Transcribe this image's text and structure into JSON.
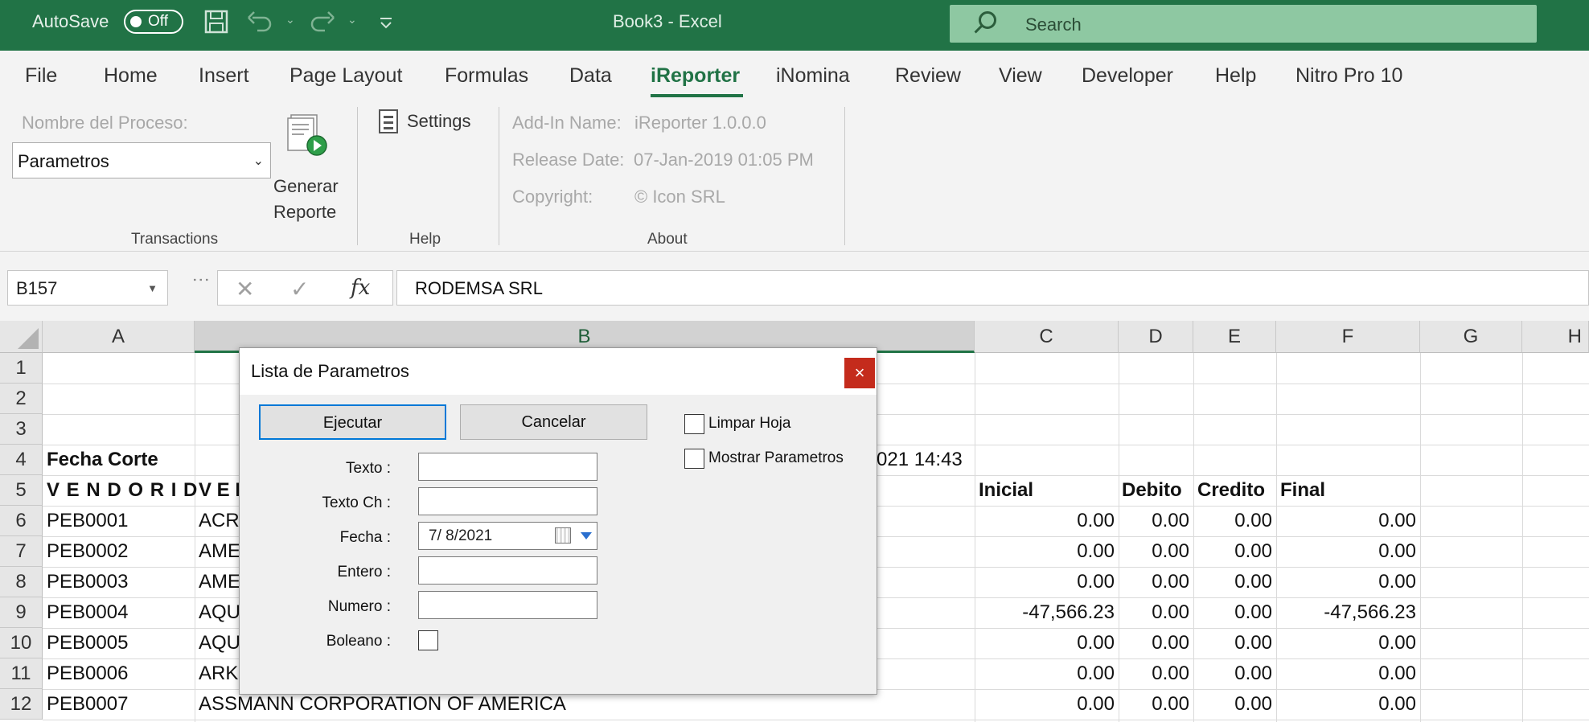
{
  "titlebar": {
    "autosave_label": "AutoSave",
    "autosave_state": "Off",
    "window_title": "Book3  -  Excel",
    "search_placeholder": "Search"
  },
  "menu": {
    "tabs": [
      {
        "label": "File"
      },
      {
        "label": "Home"
      },
      {
        "label": "Insert"
      },
      {
        "label": "Page Layout"
      },
      {
        "label": "Formulas"
      },
      {
        "label": "Data"
      },
      {
        "label": "iReporter",
        "active": true
      },
      {
        "label": "iNomina"
      },
      {
        "label": "Review"
      },
      {
        "label": "View"
      },
      {
        "label": "Developer"
      },
      {
        "label": "Help"
      },
      {
        "label": "Nitro Pro 10"
      }
    ]
  },
  "ribbon": {
    "transactions": {
      "process_label": "Nombre del Proceso:",
      "process_value": "Parametros",
      "generate_line1": "Generar",
      "generate_line2": "Reporte",
      "group_name": "Transactions"
    },
    "help": {
      "settings_label": "Settings",
      "group_name": "Help"
    },
    "about": {
      "addin_label": "Add-In Name:",
      "addin_value": "iReporter 1.0.0.0",
      "release_label": "Release Date:",
      "release_value": "07-Jan-2019 01:05 PM",
      "copyright_label": "Copyright:",
      "copyright_value": "© Icon SRL",
      "group_name": "About"
    }
  },
  "formula_bar": {
    "name_box": "B157",
    "fx_label": "fx",
    "content": "RODEMSA SRL"
  },
  "grid": {
    "columns": [
      "A",
      "B",
      "C",
      "D",
      "E",
      "F",
      "G",
      "H"
    ],
    "rows": [
      "1",
      "2",
      "3",
      "4",
      "5",
      "6",
      "7",
      "8",
      "9",
      "10",
      "11",
      "12"
    ],
    "cells": {
      "a4": "Fecha Corte",
      "b4_tail": "021 14:43",
      "a5": "V E N D O R I D",
      "b5": "V E I",
      "c5": "Inicial",
      "d5": "Debito",
      "e5": "Credito",
      "f5": "Final"
    },
    "data_rows": [
      {
        "a": "PEB0001",
        "b": "ACR",
        "c": "0.00",
        "d": "0.00",
        "e": "0.00",
        "f": "0.00"
      },
      {
        "a": "PEB0002",
        "b": "AME",
        "c": "0.00",
        "d": "0.00",
        "e": "0.00",
        "f": "0.00"
      },
      {
        "a": "PEB0003",
        "b": "AME",
        "c": "0.00",
        "d": "0.00",
        "e": "0.00",
        "f": "0.00"
      },
      {
        "a": "PEB0004",
        "b": "AQU",
        "c": "-47,566.23",
        "d": "0.00",
        "e": "0.00",
        "f": "-47,566.23"
      },
      {
        "a": "PEB0005",
        "b": "AQU",
        "c": "0.00",
        "d": "0.00",
        "e": "0.00",
        "f": "0.00"
      },
      {
        "a": "PEB0006",
        "b": "ARKI",
        "c": "0.00",
        "d": "0.00",
        "e": "0.00",
        "f": "0.00"
      },
      {
        "a": "PEB0007",
        "b": "ASSMANN CORPORATION OF AMERICA",
        "c": "0.00",
        "d": "0.00",
        "e": "0.00",
        "f": "0.00"
      }
    ]
  },
  "dialog": {
    "title": "Lista de Parametros",
    "close": "×",
    "execute_label": "Ejecutar",
    "cancel_label": "Cancelar",
    "clear_sheet_label": "Limpar Hoja",
    "show_params_label": "Mostrar Parametros",
    "fields": {
      "texto_label": "Texto :",
      "texto_value": "",
      "texto_ch_label": "Texto Ch :",
      "texto_ch_value": "",
      "fecha_label": "Fecha :",
      "fecha_value": "7/  8/2021",
      "entero_label": "Entero :",
      "entero_value": "",
      "numero_label": "Numero :",
      "numero_value": "",
      "boleano_label": "Boleano :"
    }
  }
}
